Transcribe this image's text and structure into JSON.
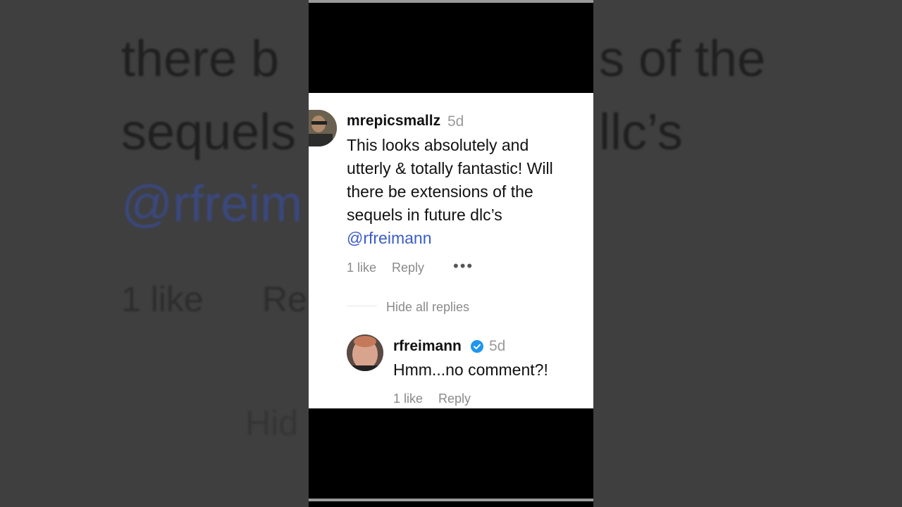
{
  "background": {
    "line1": "there b",
    "line1b": "s of the",
    "line2": "sequels",
    "line2b": "llc’s",
    "line3": "@rfreim",
    "line4a": "1 like",
    "line4b": "Re",
    "line5": "Hid"
  },
  "comment": {
    "username": "mrepicsmallz",
    "time": "5d",
    "line1": "This looks absolutely and",
    "line2": "utterly & totally fantastic! Will",
    "line3": "there be extensions of the",
    "line4": "sequels in future dlc’s",
    "mention": "@rfreimann",
    "likes": "1 like",
    "reply": "Reply",
    "more": "•••",
    "hide_replies": "Hide all replies"
  },
  "reply": {
    "username": "rfreimann",
    "time": "5d",
    "text": "Hmm...no comment?!",
    "likes": "1 like",
    "reply": "Reply"
  },
  "colors": {
    "mention": "#3a5cc8",
    "verified": "#1e96f0"
  }
}
